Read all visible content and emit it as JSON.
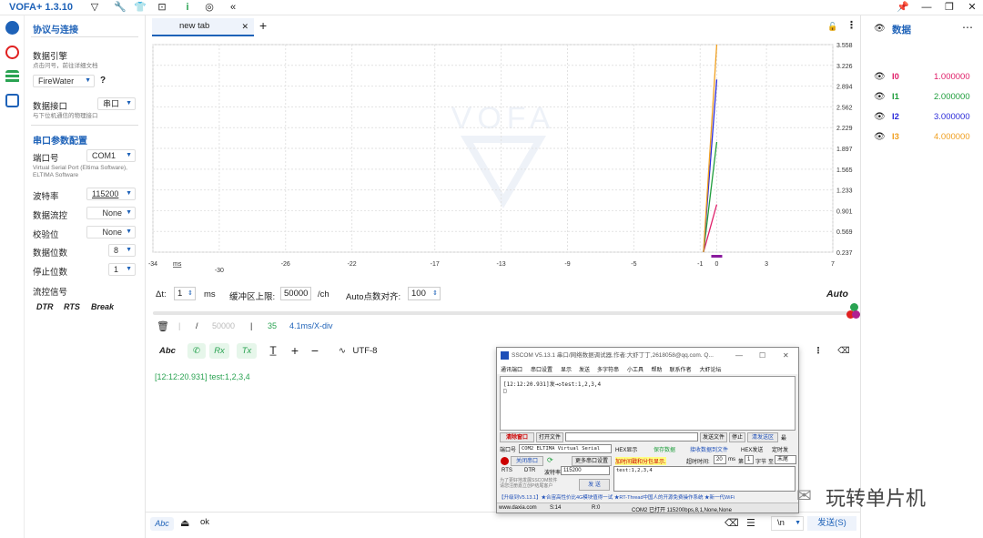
{
  "app": {
    "title": "VOFA+ 1.3.10"
  },
  "left": {
    "section_protocol": "协议与连接",
    "engine_label": "数据引擎",
    "engine_hint": "点击问号，前往详细文档",
    "engine_value": "FireWater",
    "engine_help": "?",
    "interface_label": "数据接口",
    "interface_value": "串口",
    "interface_hint": "与下位机通信的物理接口",
    "section_serial": "串口参数配置",
    "port_label": "端口号",
    "port_value": "COM1",
    "port_desc": "Virtual Serial Port (Eltima Software), ELTIMA Software",
    "baud_label": "波特率",
    "baud_value": "115200",
    "flow_label": "数据流控",
    "flow_value": "None",
    "parity_label": "校验位",
    "parity_value": "None",
    "databits_label": "数据位数",
    "databits_value": "8",
    "stopbits_label": "停止位数",
    "stopbits_value": "1",
    "signal_label": "流控信号",
    "dtr": "DTR",
    "rts": "RTS",
    "brk": "Break"
  },
  "tabs": {
    "active": "new tab",
    "add": "+"
  },
  "chart_data": {
    "type": "line",
    "xlabel": "ms",
    "xlim": [
      -34,
      7
    ],
    "ylim": [
      0.237,
      3.558
    ],
    "x_ticks": [
      "-34",
      "-30",
      "-26",
      "-22",
      "-17",
      "-13",
      "-9",
      "-5",
      "-1",
      "0",
      "3",
      "7"
    ],
    "y_ticks": [
      "3.558",
      "3.226",
      "2.894",
      "2.562",
      "2.229",
      "1.897",
      "1.565",
      "1.233",
      "0.901",
      "0.569",
      "0.237"
    ],
    "watermark": "VOFA",
    "series": [
      {
        "name": "I0",
        "color": "#e0206a",
        "x": [
          -0.8,
          0
        ],
        "y": [
          0.237,
          1.0
        ]
      },
      {
        "name": "I1",
        "color": "#1f9e3c",
        "x": [
          -0.8,
          0
        ],
        "y": [
          0.237,
          2.0
        ]
      },
      {
        "name": "I2",
        "color": "#2b2bd9",
        "x": [
          -0.8,
          0
        ],
        "y": [
          0.237,
          3.0
        ]
      },
      {
        "name": "I3",
        "color": "#f0a020",
        "x": [
          -0.8,
          0
        ],
        "y": [
          0.237,
          3.558
        ]
      }
    ]
  },
  "controls": {
    "dt_label": "Δt:",
    "dt_value": "1",
    "dt_unit": "ms",
    "buffer_label": "缓冲区上限:",
    "buffer_value": "50000",
    "buffer_unit": "/ch",
    "auto_label": "Auto点数对齐:",
    "auto_value": "100",
    "auto_mode": "Auto"
  },
  "status": {
    "slash": "/",
    "total": "50000",
    "sep": "|",
    "count": "35",
    "rate": "4.1ms/X-div"
  },
  "terminal": {
    "abc": "Abc",
    "rx": "Rx",
    "tx": "Tx",
    "encoding": "UTF-8",
    "log_line": "[12:12:20.931] test:1,2,3,4"
  },
  "bottom": {
    "abc": "Abc",
    "input_value": "ok",
    "newline": "\\n",
    "send": "发送(S)"
  },
  "right": {
    "title": "数据",
    "channels": [
      {
        "name": "I0",
        "value": "1.000000",
        "color": "#e0206a"
      },
      {
        "name": "I1",
        "value": "2.000000",
        "color": "#1f9e3c"
      },
      {
        "name": "I2",
        "value": "3.000000",
        "color": "#2b2bd9"
      },
      {
        "name": "I3",
        "value": "4.000000",
        "color": "#f0a020"
      }
    ]
  },
  "sscom": {
    "title": "SSCOM V5.13.1 串口/网络数据调试器,作者:大虾丁丁,2618058@qq.com. Q...",
    "menu": [
      "通讯端口",
      "串口设置",
      "显示",
      "发送",
      "多字符串",
      "小工具",
      "帮助",
      "联系作者",
      "大虾论坛"
    ],
    "recv_text": "[12:12:20.931]发→◇test:1,2,3,4",
    "recv_cursor": "□",
    "btn_clear": "清除窗口",
    "btn_open_file": "打开文件",
    "btn_send_file": "发送文件",
    "btn_stop": "停止",
    "btn_clear_send": "清发送区",
    "chk_last": "最",
    "port_label": "端口号",
    "port_value": "COM2 ELTIMA Virtual Serial",
    "hex_show": "HEX显示",
    "save_data": "保存数据",
    "recv_to_file": "接收数据到文件",
    "hex_send": "HEX发送",
    "timed_send": "定时发",
    "btn_close_port": "关闭串口",
    "more_settings": "更多串口设置",
    "timestamp": "加时间戳和分包显示.",
    "timeout_label": "超时时间:",
    "timeout_value": "20",
    "ms": "ms",
    "nth": "第",
    "byte_value": "1",
    "byte_label": "字节",
    "to": "至",
    "tail": "末尾",
    "rts": "RTS",
    "dtr": "DTR",
    "baud_label": "波特率:",
    "baud_value": "115200",
    "send_text": "test:1,2,3,4",
    "promo": "为了更好地发展SSCOM软件\n请您注册嘉立创P结尾客户",
    "btn_send": "发 送",
    "ad": "【升级到V5.13.1】★合宙高性价比4G模块值得一试 ★RT-Thread中国人的开源免费操作系统 ★新一代WiFi",
    "status_url": "www.daxia.com",
    "status_s": "S:14",
    "status_r": "R:0",
    "status_port": "COM2 已打开  115200bps,8,1,None,None"
  },
  "watermark_logo": "玩转单片机"
}
